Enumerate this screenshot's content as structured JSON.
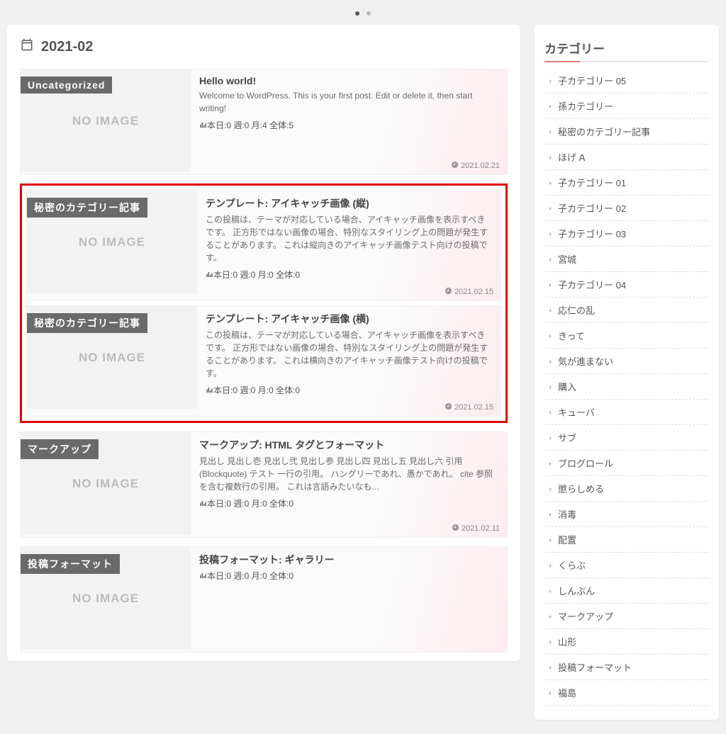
{
  "archive": {
    "title": "2021-02"
  },
  "noimage_label": "NO IMAGE",
  "posts": [
    {
      "category": "Uncategorized",
      "title": "Hello world!",
      "excerpt": "Welcome to WordPress. This is your first post. Edit or delete it, then start writing!",
      "stats": "本日:0 週:0 月:4 全体:5",
      "date": "2021.02.21",
      "highlight": false
    },
    {
      "category": "秘密のカテゴリー記事",
      "title": "テンプレート: アイキャッチ画像 (縦)",
      "excerpt": "この投稿は、テーマが対応している場合、アイキャッチ画像を表示すべきです。 正方形ではない画像の場合、特別なスタイリング上の問題が発生することがあります。 これは縦向きのアイキャッチ画像テスト向けの投稿です。",
      "stats": "本日:0 週:0 月:0 全体:0",
      "date": "2021.02.15",
      "highlight": true
    },
    {
      "category": "秘密のカテゴリー記事",
      "title": "テンプレート: アイキャッチ画像 (横)",
      "excerpt": "この投稿は、テーマが対応している場合、アイキャッチ画像を表示すべきです。 正方形ではない画像の場合、特別なスタイリング上の問題が発生することがあります。 これは横向きのアイキャッチ画像テスト向けの投稿です。",
      "stats": "本日:0 週:0 月:0 全体:0",
      "date": "2021.02.15",
      "highlight": true
    },
    {
      "category": "マークアップ",
      "title": "マークアップ: HTML タグとフォーマット",
      "excerpt": "見出し 見出し壱 見出し弐 見出し参 見出し四 見出し五 見出し六 引用 (Blockquote) テスト 一行の引用。 ハングリーであれ、愚かであれ。 cite 参照を含む複数行の引用。 これは言語みたいなも...",
      "stats": "本日:0 週:0 月:0 全体:0",
      "date": "2021.02.11",
      "highlight": false
    },
    {
      "category": "投稿フォーマット",
      "title": "投稿フォーマット: ギャラリー",
      "excerpt": "",
      "stats": "本日:0 週:0 月:0 全体:0",
      "date": "",
      "highlight": false
    }
  ],
  "sidebar": {
    "title": "カテゴリー",
    "items": [
      "子カテゴリー 05",
      "孫カテゴリー",
      "秘密のカテゴリー記事",
      "ほげ A",
      "子カテゴリー 01",
      "子カテゴリー 02",
      "子カテゴリー 03",
      "宮城",
      "子カテゴリー 04",
      "応仁の乱",
      "きって",
      "気が進まない",
      "購入",
      "キューバ",
      "サブ",
      "ブログロール",
      "懲らしめる",
      "消毒",
      "配置",
      "くらぶ",
      "しんぶん",
      "マークアップ",
      "山形",
      "投稿フォーマット",
      "福島"
    ]
  }
}
